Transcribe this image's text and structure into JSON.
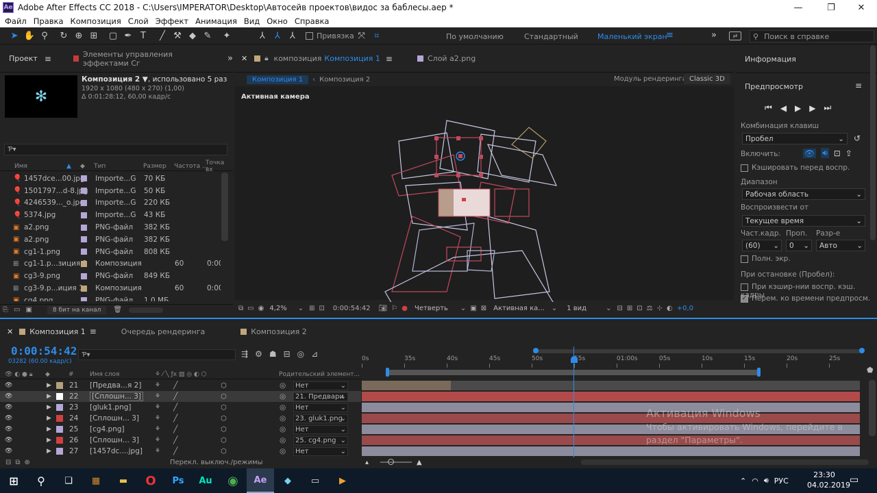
{
  "title_bar": {
    "app_icon": "Ae",
    "title": "Adobe After Effects CC 2018 - C:\\Users\\IMPERATOR\\Desktop\\Автосейв проектов\\видос за баблесы.aep *",
    "minimize": "—",
    "maximize": "❐",
    "close": "✕"
  },
  "menu": [
    "Файл",
    "Правка",
    "Композиция",
    "Слой",
    "Эффект",
    "Анимация",
    "Вид",
    "Окно",
    "Справка"
  ],
  "toolbar": {
    "snapping": "Привязка",
    "workspaces": [
      "По умолчанию",
      "Стандартный",
      "Маленький экран"
    ],
    "search_placeholder": "Поиск в справке",
    "more": "»"
  },
  "project": {
    "tab": "Проект",
    "effects_tab": "Элементы управления эффектами Сг",
    "comp_name": "Композиция 2 ▼",
    "comp_used": ", использовано 5 раз",
    "comp_res": "1920 x 1080  (480 x 270) (1,00)",
    "comp_dur": "Δ 0:01:28:12, 60,00 кадр/с",
    "search_placeholder": "Ƥ▾",
    "columns": {
      "name": "Имя",
      "type": "Тип",
      "size": "Размер",
      "fps": "Частота ...",
      "in": "Точка вх"
    },
    "items": [
      {
        "icon": "balloon",
        "name": "1457dce...00.jpg",
        "color": "#b4a7d6",
        "type": "Importe...G",
        "size": "70 КБ",
        "fps": "",
        "in": ""
      },
      {
        "icon": "balloon",
        "name": "1501797...d-8.jpg",
        "color": "#b4a7d6",
        "type": "Importe...G",
        "size": "50 КБ",
        "fps": "",
        "in": ""
      },
      {
        "icon": "balloon",
        "name": "4246539..._o.jpg",
        "color": "#b4a7d6",
        "type": "Importe...G",
        "size": "220 КБ",
        "fps": "",
        "in": ""
      },
      {
        "icon": "balloon",
        "name": "5374.jpg",
        "color": "#b4a7d6",
        "type": "Importe...G",
        "size": "43 КБ",
        "fps": "",
        "in": ""
      },
      {
        "icon": "png",
        "name": "a2.png",
        "color": "#b4a7d6",
        "type": "PNG-файл",
        "size": "382 КБ",
        "fps": "",
        "in": ""
      },
      {
        "icon": "png",
        "name": "a2.png",
        "color": "#b4a7d6",
        "type": "PNG-файл",
        "size": "382 КБ",
        "fps": "",
        "in": ""
      },
      {
        "icon": "png",
        "name": "cg1-1.png",
        "color": "#b4a7d6",
        "type": "PNG-файл",
        "size": "808 КБ",
        "fps": "",
        "in": ""
      },
      {
        "icon": "comp",
        "name": "cg1-1.p...зиция 1",
        "color": "#c0a67a",
        "type": "Композиция",
        "size": "",
        "fps": "60",
        "in": "0:00"
      },
      {
        "icon": "png",
        "name": "cg3-9.png",
        "color": "#b4a7d6",
        "type": "PNG-файл",
        "size": "849 КБ",
        "fps": "",
        "in": ""
      },
      {
        "icon": "comp",
        "name": "cg3-9.p...иция 1",
        "color": "#c0a67a",
        "type": "Композиция",
        "size": "",
        "fps": "60",
        "in": "0:00"
      },
      {
        "icon": "png",
        "name": "cg4.png",
        "color": "#b4a7d6",
        "type": "PNG-файл",
        "size": "1,0 МБ",
        "fps": "",
        "in": ""
      }
    ],
    "bit_depth": "8 бит на канал"
  },
  "viewer": {
    "tab_prefix": "композиция",
    "tab_comp": "Композиция 1",
    "layer_tab": "Слой a2.png",
    "breadcrumb": [
      "Композиция 1",
      "Композиция 2"
    ],
    "renderer_label": "Модуль рендеринга:",
    "renderer": "Classic 3D",
    "camera_label": "Активная камера",
    "zoom": "4,2%",
    "time": "0:00:54:42",
    "resolution": "Четверть",
    "view_camera": "Активная ка...",
    "views": "1 вид",
    "exposure": "+0,0"
  },
  "info": {
    "tab": "Информация",
    "preview_tab": "Предпросмотр",
    "shortcut_label": "Комбинация клавиш",
    "shortcut": "Пробел",
    "include_label": "Включить:",
    "cache_before": "Кэшировать перед воспр.",
    "range_label": "Диапазон",
    "range": "Рабочая область",
    "play_from_label": "Воспроизвести от",
    "play_from": "Текущее время",
    "fps_label": "Част.кадр.",
    "skip_label": "Проп.",
    "res_label": "Разр-е",
    "fps": "(60)",
    "skip": "0",
    "res": "Авто",
    "fullscreen": "Полн. экр.",
    "on_stop_label": "При остановке (Пробел):",
    "cache_opt": "При кэшир-нии воспр. кэш. кадры",
    "move_time": "Перем. ко времени предпросм."
  },
  "timeline": {
    "tabs": [
      "Композиция 1",
      "Очередь рендеринга",
      "Композиция 2"
    ],
    "timecode": "0:00:54:42",
    "frame_info": "03282 (60.00 кадр/с)",
    "search_placeholder": "Ƥ▾",
    "col_name": "Имя слоя",
    "col_parent": "Родительский элемент...",
    "col_num": "#",
    "ruler": [
      "0s",
      "35s",
      "40s",
      "45s",
      "50s",
      "55s",
      "01:00s",
      "05s",
      "10s",
      "15s",
      "20s",
      "25s"
    ],
    "layers": [
      {
        "num": "21",
        "name": "[Предва...я 2]",
        "label": "#b4a07a",
        "parent": "Нет",
        "bar": "#7a6a5a",
        "sel": false
      },
      {
        "num": "22",
        "name": "[Сплошн... 3]",
        "label": "#ffffff",
        "parent": "21. Предвари",
        "bar": "#b24a4a",
        "sel": true
      },
      {
        "num": "23",
        "name": "[gluk1.png]",
        "label": "#b4a7d6",
        "parent": "Нет",
        "bar": "#8c8c9c",
        "sel": false
      },
      {
        "num": "24",
        "name": "[Сплошн... 3]",
        "label": "#d04040",
        "parent": "23. gluk1.png",
        "bar": "#9a4a4a",
        "sel": false
      },
      {
        "num": "25",
        "name": "[cg4.png]",
        "label": "#b4a7d6",
        "parent": "Нет",
        "bar": "#8c8c9c",
        "sel": false
      },
      {
        "num": "26",
        "name": "[Сплошн... 3]",
        "label": "#d04040",
        "parent": "25. cg4.png",
        "bar": "#9a4a4a",
        "sel": false
      },
      {
        "num": "27",
        "name": "[1457dc....jpg]",
        "label": "#b4a7d6",
        "parent": "Нет",
        "bar": "#8c8c9c",
        "sel": false
      }
    ],
    "footer": "Перекл. выключ./режимы"
  },
  "watermark": {
    "line1": "Активация Windows",
    "line2": "Чтобы активировать Windows, перейдите в",
    "line3": "раздел \"Параметры\"."
  },
  "taskbar": {
    "lang": "РУС",
    "time": "23:30",
    "date": "04.02.2019"
  },
  "colors": {
    "accent": "#2d8ceb",
    "bg": "#232323",
    "panel_dark": "#1b1b1b"
  }
}
